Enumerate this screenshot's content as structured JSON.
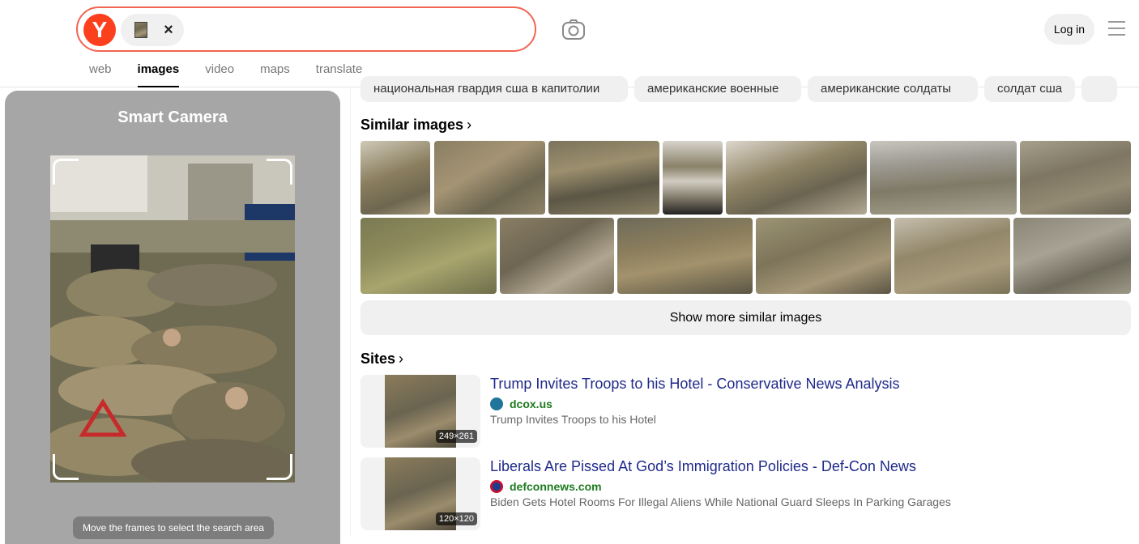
{
  "header": {
    "logo_letter": "Y",
    "login_label": "Log in",
    "tabs": [
      {
        "label": "web",
        "active": false
      },
      {
        "label": "images",
        "active": true
      },
      {
        "label": "video",
        "active": false
      },
      {
        "label": "maps",
        "active": false
      },
      {
        "label": "translate",
        "active": false
      }
    ]
  },
  "smart_camera": {
    "title": "Smart Camera",
    "hint": "Move the frames to select the search area"
  },
  "related_queries": [
    "национальная гвардия сша в капитолии",
    "американские военные",
    "американские солдаты",
    "солдат сша"
  ],
  "similar": {
    "title": "Similar images",
    "show_more_label": "Show more similar images"
  },
  "sites": {
    "title": "Sites",
    "items": [
      {
        "title": "Trump Invites Troops to his Hotel - Conservative News Analysis",
        "domain": "dcox.us",
        "description": "Trump Invites Troops to his Hotel",
        "dims": "249×261",
        "favicon_color": "#21759b"
      },
      {
        "title": "Liberals Are Pissed At God’s Immigration Policies - Def-Con News",
        "domain": "defconnews.com",
        "description": "Biden Gets Hotel Rooms For Illegal Aliens While National Guard Sleeps In Parking Garages",
        "dims": "120×120",
        "favicon_color": "#c8102e"
      }
    ]
  },
  "colors": {
    "brand": "#fc3f1d",
    "search_border": "#f26552",
    "link": "#1f2a8a",
    "domain": "#1e7a1e"
  }
}
